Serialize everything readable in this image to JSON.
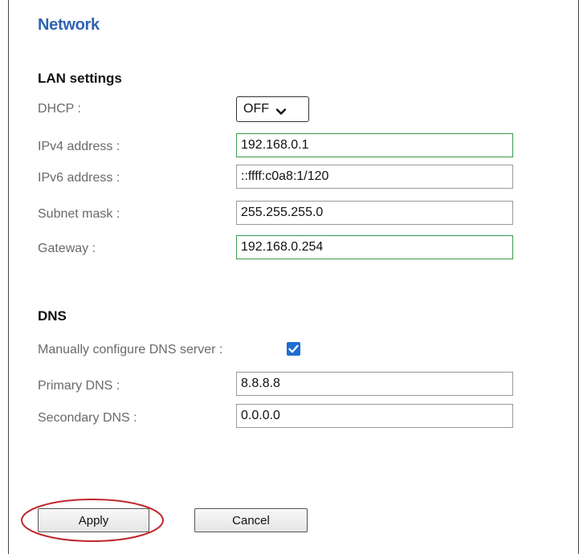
{
  "page": {
    "title": "Network"
  },
  "lan": {
    "heading": "LAN settings",
    "dhcp": {
      "label": "DHCP :",
      "value": "OFF"
    },
    "ipv4": {
      "label": "IPv4 address :",
      "value": "192.168.0.1"
    },
    "ipv6": {
      "label": "IPv6 address :",
      "value": "::ffff:c0a8:1/120"
    },
    "subnet": {
      "label": "Subnet mask :",
      "value": "255.255.255.0"
    },
    "gateway": {
      "label": "Gateway :",
      "value": "192.168.0.254"
    }
  },
  "dns": {
    "heading": "DNS",
    "manual": {
      "label": "Manually configure DNS server :",
      "checked": true
    },
    "primary": {
      "label": "Primary DNS :",
      "value": "8.8.8.8"
    },
    "secondary": {
      "label": "Secondary DNS :",
      "value": "0.0.0.0"
    }
  },
  "actions": {
    "apply_label": "Apply",
    "cancel_label": "Cancel"
  },
  "colors": {
    "title": "#2f63b1",
    "focus_border": "#3b9a4e",
    "checkbox": "#1e6fd0",
    "highlight": "#c0272d"
  },
  "icons": {
    "dhcp_select": "chevron-down-icon",
    "manual_dns": "checkmark-icon"
  }
}
